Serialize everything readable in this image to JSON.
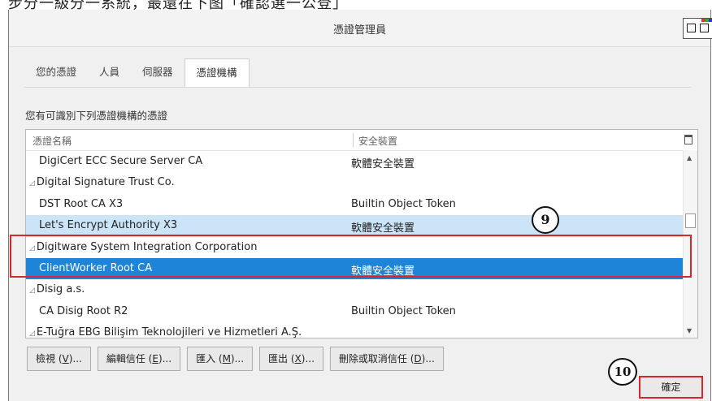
{
  "top_caption": "步分一級分一系統，最還在下图「確認選一公登」",
  "window": {
    "title": "憑證管理員"
  },
  "tabs": [
    "您的憑證",
    "人員",
    "伺服器",
    "憑證機構"
  ],
  "active_tab": "憑證機構",
  "description": "您有可識別下列憑證機構的憑證",
  "table": {
    "columns": [
      "憑證名稱",
      "安全裝置"
    ],
    "rows": [
      {
        "name": "DigiCert ECC Secure Server CA",
        "device": "軟體安全裝置",
        "kind": "child",
        "highlight": "none"
      },
      {
        "name": "Digital Signature Trust Co.",
        "device": "",
        "kind": "group",
        "highlight": "none"
      },
      {
        "name": "DST Root CA X3",
        "device": "Builtin Object Token",
        "kind": "child",
        "highlight": "none"
      },
      {
        "name": "Let's Encrypt Authority X3",
        "device": "軟體安全裝置",
        "kind": "child",
        "highlight": "light"
      },
      {
        "name": "Digitware System Integration Corporation",
        "device": "",
        "kind": "group",
        "highlight": "none"
      },
      {
        "name": "ClientWorker Root CA",
        "device": "軟體安全裝置",
        "kind": "child",
        "highlight": "selected"
      },
      {
        "name": "Disig a.s.",
        "device": "",
        "kind": "group",
        "highlight": "none"
      },
      {
        "name": "CA Disig Root R2",
        "device": "Builtin Object Token",
        "kind": "child",
        "highlight": "none"
      },
      {
        "name": "E-Tuğra EBG Bilişim Teknolojileri ve Hizmetleri A.Ş.",
        "device": "",
        "kind": "group",
        "highlight": "none"
      }
    ]
  },
  "buttons": [
    {
      "text": "檢視 (",
      "key": "V",
      "tail": ")..."
    },
    {
      "text": "編輯信任 (",
      "key": "E",
      "tail": ")..."
    },
    {
      "text": "匯入 (",
      "key": "M",
      "tail": ")..."
    },
    {
      "text": "匯出 (",
      "key": "X",
      "tail": ")..."
    },
    {
      "text": "刪除或取消信任 (",
      "key": "D",
      "tail": ")..."
    }
  ],
  "ok_button": "確定",
  "annotations": [
    "9",
    "10"
  ],
  "colors": {
    "selection": "#1e84d8",
    "hover_row": "#cce4f7",
    "annotation_red": "#d8262d"
  }
}
